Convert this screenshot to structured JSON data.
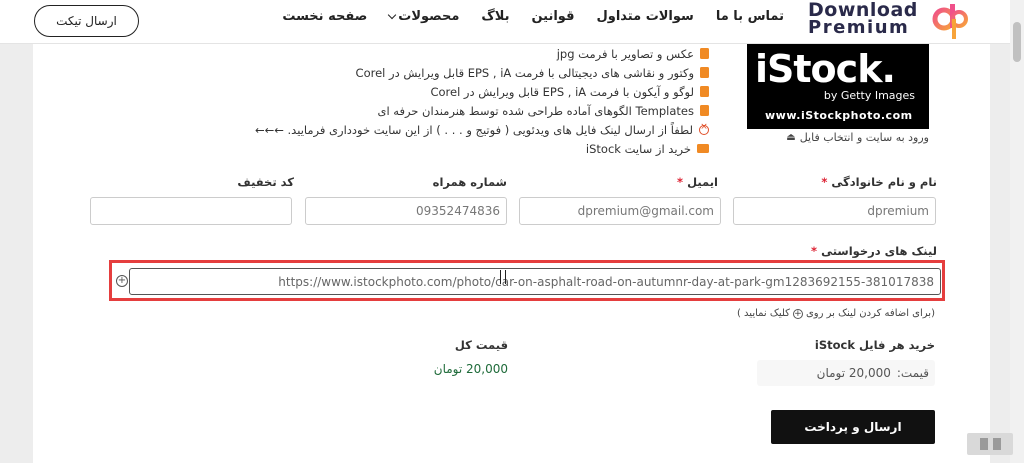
{
  "header": {
    "ticket_button": "ارسال تیکت",
    "nav": [
      {
        "label": "صفحه نخست",
        "dropdown": false
      },
      {
        "label": "محصولات",
        "dropdown": true
      },
      {
        "label": "بلاگ",
        "dropdown": false
      },
      {
        "label": "قوانین",
        "dropdown": false
      },
      {
        "label": "سوالات متداول",
        "dropdown": false
      },
      {
        "label": "تماس با ما",
        "dropdown": false
      }
    ],
    "logo_line1": "Download",
    "logo_line2": "Premium"
  },
  "istock": {
    "logo": "iStock.",
    "getty": "by Getty Images",
    "url": "www.iStockphoto.com",
    "login_link": "ورود به سایت و انتخاب فایل"
  },
  "features": [
    "عکس و تصاویر با فرمت jpg",
    "وکتور و نقاشی های دیجیتالی با فرمت EPS , iA قابل ویرایش در Corel",
    "لوگو و آیکون با فرمت EPS , iA قابل ویرایش در Corel",
    "Templates الگوهای آماده طراحی شده توسط هنرمندان حرفه ای",
    "لطفاً از ارسال لینک فایل های ویدئویی ( فوتیج و . . . ) از این سایت خودداری فرمایید. ←←←",
    "خرید از سایت iStock"
  ],
  "form": {
    "name_label": "نام و نام خانوادگی",
    "name_value": "dpremium",
    "email_label": "ایمیل",
    "email_value": "dpremium@gmail.com",
    "phone_label": "شماره همراه",
    "phone_value": "09352474836",
    "discount_label": "کد تخفیف",
    "discount_value": "",
    "links_label": "لینک های درخواستی",
    "link_value": "https://www.istockphoto.com/photo/car-on-asphalt-road-on-autumnr-day-at-park-gm1283692155-381017838",
    "hint": "(برای اضافه کردن لینک بر روی",
    "hint_end": "کلیک نمایید )",
    "per_file_label": "خرید هر فایل iStock",
    "price_label": "قیمت:",
    "price_value": "20,000 تومان",
    "total_label": "قیمت کل",
    "total_value": "20,000 تومان",
    "submit": "ارسال و پرداخت",
    "required_mark": "*"
  }
}
